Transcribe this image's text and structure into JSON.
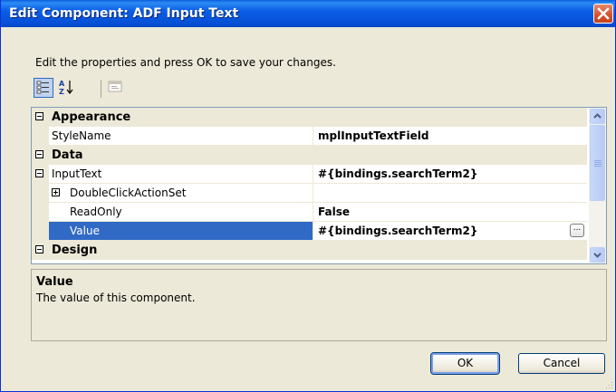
{
  "dialog": {
    "title": "Edit Component: ADF Input Text",
    "instructions": "Edit the properties and press OK to save your changes."
  },
  "toolbar": {
    "buttons": [
      {
        "name": "categorized-view",
        "icon": "categorized-icon",
        "pressed": true
      },
      {
        "name": "alphabetical-sort",
        "icon": "az-sort-icon",
        "pressed": false
      },
      {
        "name": "property-pages",
        "icon": "property-pages-icon",
        "pressed": false,
        "disabled": true
      }
    ]
  },
  "grid": {
    "categories": {
      "appearance": "Appearance",
      "data": "Data",
      "design": "Design"
    },
    "rows": {
      "stylename": {
        "name": "StyleName",
        "value": "mplInputTextField"
      },
      "inputtext": {
        "name": "InputText",
        "value": "#{bindings.searchTerm2}"
      },
      "doubleclick": {
        "name": "DoubleClickActionSet",
        "value": ""
      },
      "readonly": {
        "name": "ReadOnly",
        "value": "False"
      },
      "value": {
        "name": "Value",
        "value": "#{bindings.searchTerm2}"
      }
    },
    "ellipsis_label": "..."
  },
  "description": {
    "title": "Value",
    "text": "The value of this component."
  },
  "buttons": {
    "ok": "OK",
    "cancel": "Cancel"
  },
  "colors": {
    "title_bar": "#0a5de6",
    "selection": "#316ac5",
    "dialog_bg": "#ece9d8",
    "close_button": "#d3512c"
  }
}
